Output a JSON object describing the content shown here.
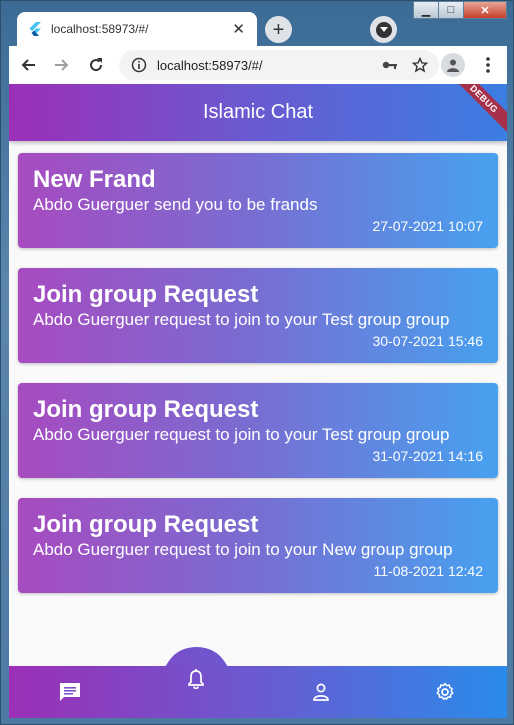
{
  "browser": {
    "tab_title": "localhost:58973/#/",
    "tab_close": "✕",
    "new_tab": "+",
    "url": "localhost:58973/#/"
  },
  "window_controls": {
    "minimize": "▁",
    "maximize": "□",
    "close": "✕"
  },
  "app": {
    "title": "Islamic Chat",
    "debug_label": "DEBUG"
  },
  "notifications": [
    {
      "title": "New Frand",
      "body": "Abdo Guerguer send you to be frands",
      "date": "27-07-2021 10:07"
    },
    {
      "title": "Join group Request",
      "body": "Abdo Guerguer request to join to your Test group group",
      "date": "30-07-2021 15:46"
    },
    {
      "title": "Join group Request",
      "body": "Abdo Guerguer request to join to your Test group group",
      "date": "31-07-2021 14:16"
    },
    {
      "title": "Join group Request",
      "body": "Abdo Guerguer request to join to your New group group",
      "date": "11-08-2021 12:42"
    }
  ],
  "bottom_nav": {
    "items": [
      "chat-icon",
      "bell-icon",
      "person-icon",
      "gear-icon"
    ],
    "active": "bell-icon"
  },
  "colors": {
    "gradient_start": "#9c2fb8",
    "gradient_end": "#3b7ee2",
    "card_start": "#a74bc0",
    "card_end": "#47a1ef"
  }
}
